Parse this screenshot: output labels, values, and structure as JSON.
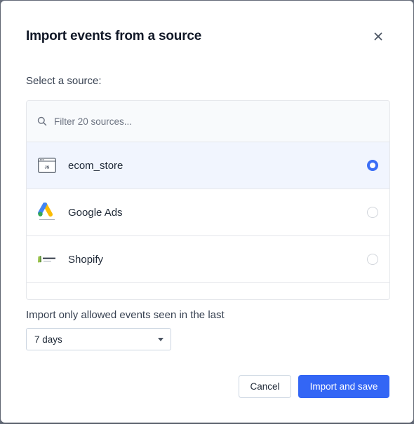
{
  "dialog": {
    "title": "Import events from a source",
    "close_icon": "close-icon"
  },
  "source_section": {
    "label": "Select a source:",
    "search": {
      "placeholder": "Filter 20 sources...",
      "value": "",
      "icon": "search-icon"
    },
    "sources": [
      {
        "name": "ecom_store",
        "icon": "javascript-source-icon",
        "selected": true
      },
      {
        "name": "Google Ads",
        "icon": "google-ads-icon",
        "selected": false
      },
      {
        "name": "Shopify",
        "icon": "shopify-icon",
        "selected": false
      }
    ]
  },
  "time_range": {
    "label": "Import only allowed events seen in the last",
    "selected": "7 days"
  },
  "footer": {
    "cancel_label": "Cancel",
    "primary_label": "Import and save"
  },
  "colors": {
    "accent": "#3366f5",
    "selected_row_bg": "#f1f5fe"
  }
}
